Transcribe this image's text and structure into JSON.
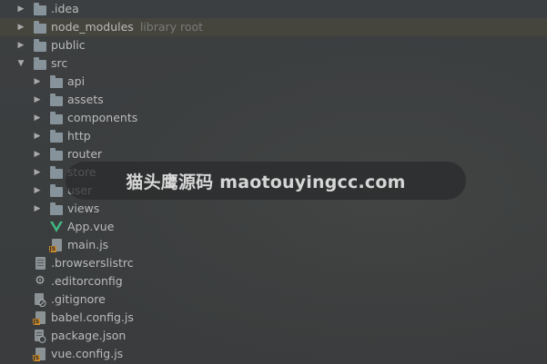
{
  "tree": {
    "items": [
      {
        "label": "idea",
        "prefix": ".",
        "icon": "folder-icon",
        "expanded": false,
        "depth": 0
      },
      {
        "label": "node_modules",
        "hint": "library root",
        "icon": "folder-icon",
        "expanded": false,
        "depth": 0,
        "selected": true
      },
      {
        "label": "public",
        "icon": "folder-icon",
        "expanded": false,
        "depth": 0
      },
      {
        "label": "src",
        "icon": "folder-icon",
        "expanded": true,
        "depth": 0
      },
      {
        "label": "api",
        "icon": "folder-icon",
        "expanded": false,
        "depth": 1
      },
      {
        "label": "assets",
        "icon": "folder-icon",
        "expanded": false,
        "depth": 1
      },
      {
        "label": "components",
        "icon": "folder-icon",
        "expanded": false,
        "depth": 1
      },
      {
        "label": "http",
        "icon": "folder-icon",
        "expanded": false,
        "depth": 1
      },
      {
        "label": "router",
        "icon": "folder-icon",
        "expanded": false,
        "depth": 1
      },
      {
        "label": "store",
        "icon": "folder-icon",
        "expanded": false,
        "depth": 1
      },
      {
        "label": "user",
        "icon": "folder-icon",
        "expanded": false,
        "depth": 1
      },
      {
        "label": "views",
        "icon": "folder-icon",
        "expanded": false,
        "depth": 1
      },
      {
        "label": "App.vue",
        "icon": "vue-file-icon",
        "depth": 1
      },
      {
        "label": "main.js",
        "icon": "js-file-icon",
        "depth": 1
      },
      {
        "label": ".browserslistrc",
        "icon": "text-file-icon",
        "depth": 0
      },
      {
        "label": ".editorconfig",
        "icon": "gear-icon",
        "depth": 0
      },
      {
        "label": ".gitignore",
        "icon": "ignore-file-icon",
        "depth": 0
      },
      {
        "label": "babel.config.js",
        "icon": "js-file-icon",
        "depth": 0
      },
      {
        "label": "package.json",
        "icon": "json-file-icon",
        "depth": 0
      },
      {
        "label": "vue.config.js",
        "icon": "js-file-icon",
        "depth": 0
      }
    ]
  },
  "watermark": {
    "banner_text": "猫头鹰源码 maotouyingcc.com"
  },
  "colors": {
    "background": "#3c3f41",
    "text": "#bbbbbb",
    "hint": "#7a7a7a",
    "selection": "#4e4a3a",
    "folder": "#87939a",
    "vue_green": "#41b883"
  }
}
